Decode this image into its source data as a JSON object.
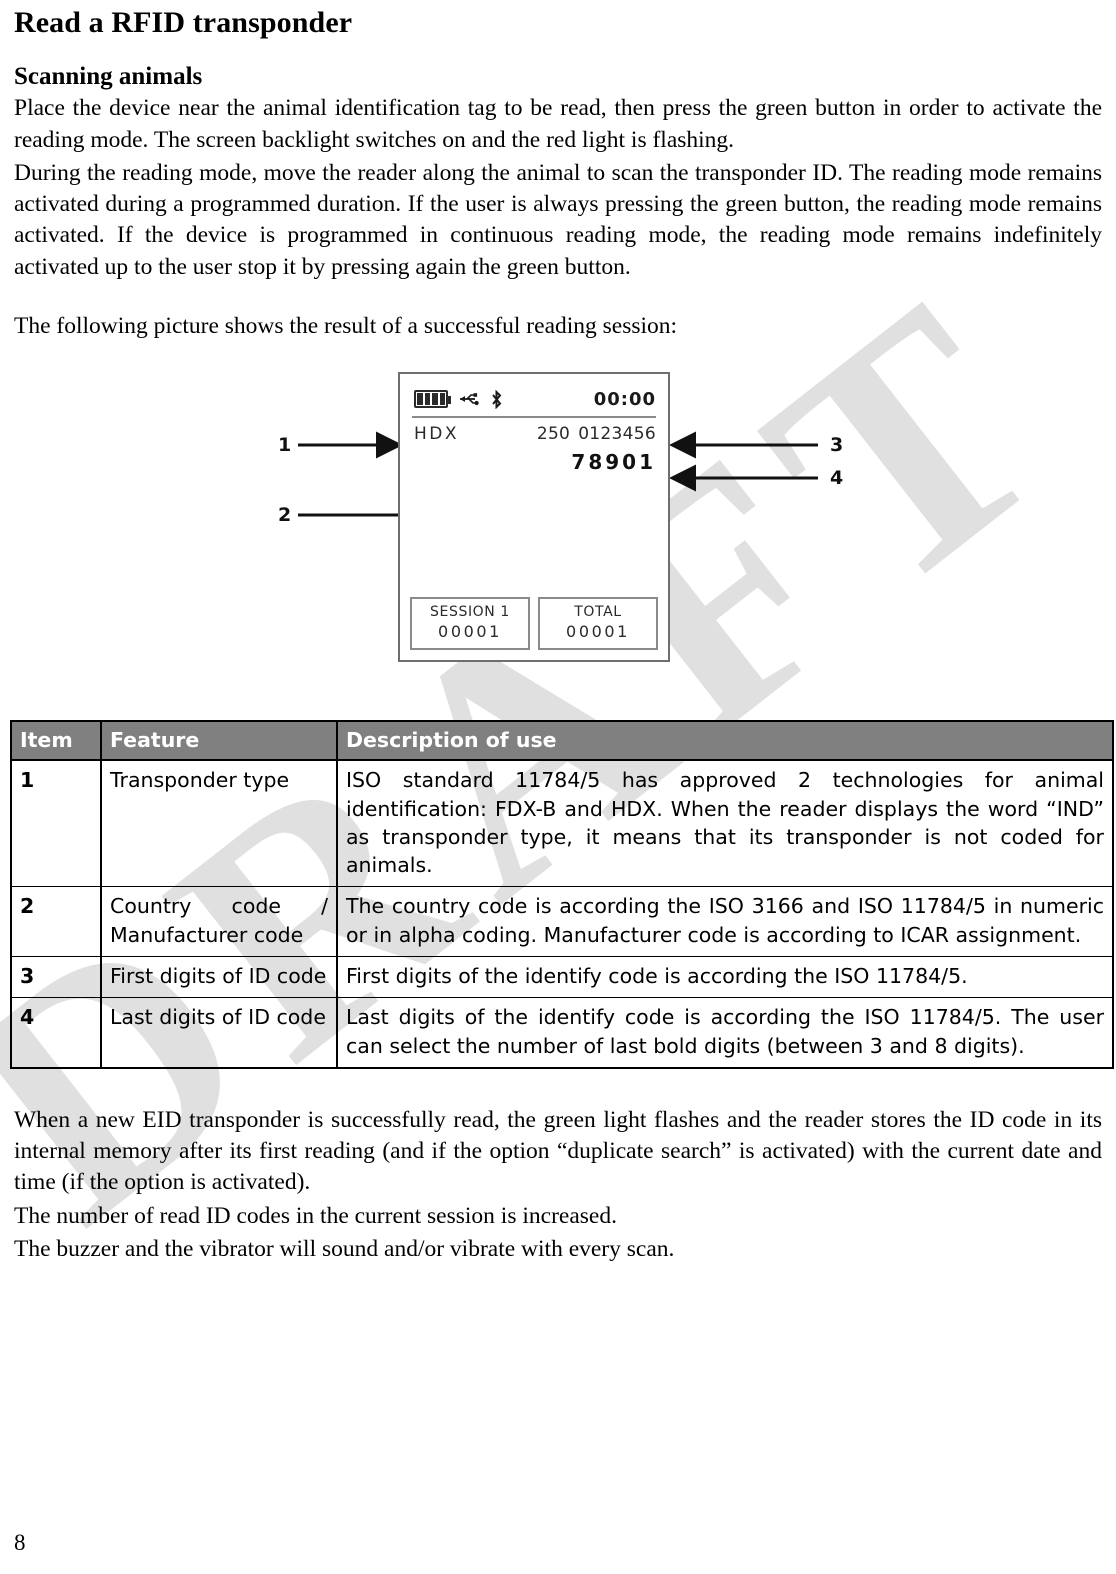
{
  "document": {
    "title": "Read a RFID transponder",
    "section_heading": "Scanning animals",
    "page_number": "8",
    "watermark": "DRAFT"
  },
  "paragraphs": {
    "p1": "Place the device near the animal identification tag to be read, then press the green button in order to activate the reading mode. The screen backlight switches on and the red light is flashing.",
    "p2": "During the reading mode, move the reader along the animal to scan the transponder ID. The reading mode remains activated during a programmed duration. If the user is always pressing the green button, the reading mode remains activated. If the device is programmed in continuous reading mode, the reading mode remains indefinitely activated up to the user stop it by pressing again the green button.",
    "p3": "The following picture shows the result of a successful reading session:",
    "p4": "When a new EID transponder is successfully read, the green light flashes and the reader stores the ID code in its internal memory after its first reading (and if the option “duplicate search” is activated) with the current date and time (if the option is activated).",
    "p5": "The number of read ID codes in the current session is increased.",
    "p6": "The buzzer and the vibrator will sound and/or vibrate with every scan."
  },
  "figure": {
    "status_bar": {
      "battery_icon": "battery-full-icon",
      "usb_icon": "usb-icon",
      "bluetooth_icon": "bluetooth-icon",
      "clock": "00:00"
    },
    "transponder_type": "HDX",
    "country_code": "250",
    "id_first_digits": "0123456",
    "id_last_digits": "78901",
    "session": {
      "label": "SESSION 1",
      "value": "00001"
    },
    "total": {
      "label": "TOTAL",
      "value": "00001"
    },
    "callouts": {
      "c1": "1",
      "c2": "2",
      "c3": "3",
      "c4": "4"
    }
  },
  "table": {
    "headers": {
      "item": "Item",
      "feature": "Feature",
      "description": "Description of use"
    },
    "rows": [
      {
        "item": "1",
        "feature": "Transponder type",
        "description": "ISO standard 11784/5 has approved 2 technologies for animal identification: FDX-B and HDX. When the reader displays the word “IND” as transponder type, it means that its transponder is not coded for animals."
      },
      {
        "item": "2",
        "feature": "Country code / Manufacturer code",
        "description": "The country code is according the ISO 3166 and ISO 11784/5 in numeric or in alpha coding. Manufacturer code is according to ICAR assignment."
      },
      {
        "item": "3",
        "feature": "First digits of ID code",
        "description": "First digits of the identify code is according the ISO 11784/5."
      },
      {
        "item": "4",
        "feature": "Last digits of ID code",
        "description": "Last digits of the identify code is according the ISO 11784/5. The user can select the number of last bold digits (between 3 and 8 digits)."
      }
    ]
  },
  "colors": {
    "table_header_bg": "#808080",
    "table_header_text": "#ffffff",
    "border": "#000000",
    "watermark": "#e0e0e0",
    "screen_border": "#6e6e6e"
  }
}
